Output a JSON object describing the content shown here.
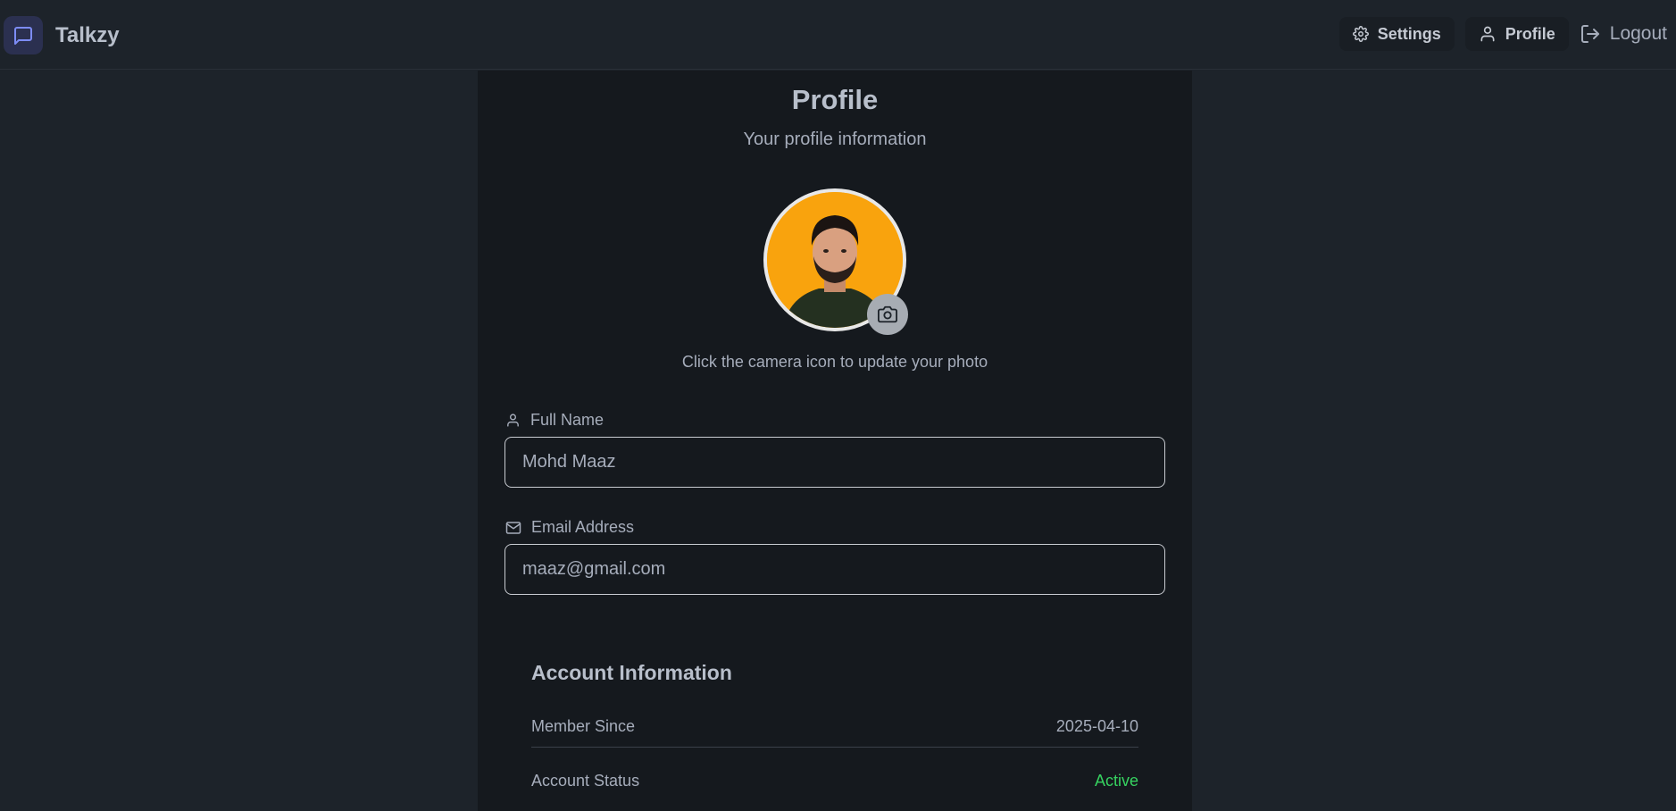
{
  "app": {
    "name": "Talkzy"
  },
  "nav": {
    "settings_label": "Settings",
    "profile_label": "Profile",
    "logout_label": "Logout"
  },
  "profile": {
    "title": "Profile",
    "subtitle": "Your profile information",
    "avatar_hint": "Click the camera icon to update your photo"
  },
  "fields": {
    "full_name_label": "Full Name",
    "full_name_value": "Mohd Maaz",
    "email_label": "Email Address",
    "email_value": "maaz@gmail.com"
  },
  "account": {
    "title": "Account Information",
    "member_since_label": "Member Since",
    "member_since_value": "2025-04-10",
    "status_label": "Account Status",
    "status_value": "Active"
  },
  "colors": {
    "accent": "#6b7cf6",
    "avatar_bg": "#f9a30d",
    "status_active": "#36d360"
  }
}
